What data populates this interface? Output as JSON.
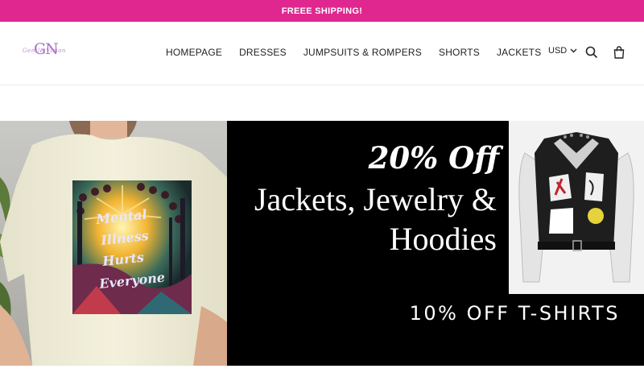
{
  "announcement": {
    "text": "FREEE SHIPPING!"
  },
  "header": {
    "logo": {
      "monogram": "GN",
      "script_text": "Gentle Vision"
    },
    "nav": [
      {
        "label": "HOMEPAGE"
      },
      {
        "label": "DRESSES"
      },
      {
        "label": "JUMPSUITS & ROMPERS"
      },
      {
        "label": "SHORTS"
      },
      {
        "label": "JACKETS"
      }
    ],
    "currency": "USD",
    "icons": {
      "search": "search-icon",
      "cart": "cart-icon",
      "dropdown": "chevron-down-icon"
    }
  },
  "hero": {
    "promo_title": "20% Off",
    "promo_line1": "Jackets, Jewelry &",
    "promo_line2": "Hoodies",
    "promo_tshirts": "10% OFF T-SHIRTS",
    "shirt_print": [
      "Mental",
      "Illness",
      "Hurts",
      "Everyone"
    ]
  },
  "colors": {
    "announcement_bg": "#e0268f",
    "hero_bg": "#000000",
    "logo": "#a673c4"
  }
}
